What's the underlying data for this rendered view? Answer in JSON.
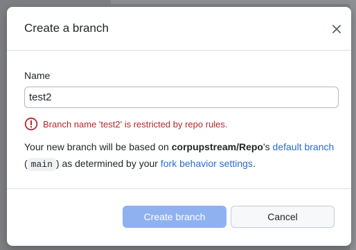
{
  "dialog": {
    "title": "Create a branch",
    "close_icon": "close-icon"
  },
  "form": {
    "name_label": "Name",
    "name_value": "test2",
    "error_icon": "alert-circle-icon",
    "error_message": "Branch name 'test2' is restricted by repo rules."
  },
  "description": {
    "part1": "Your new branch will be based on ",
    "repo": "corpupstream/Repo",
    "part2": "'s ",
    "link_default_branch": "default branch",
    "paren_open": " (",
    "branch_code": "main",
    "paren_close": ")",
    "part3": " as determined by your ",
    "link_fork_settings": "fork behavior settings",
    "period": "."
  },
  "footer": {
    "create_label": "Create branch",
    "cancel_label": "Cancel"
  },
  "colors": {
    "error": "#b3282d",
    "link": "#2a6bd1",
    "primary_disabled": "#8fb1ef"
  }
}
